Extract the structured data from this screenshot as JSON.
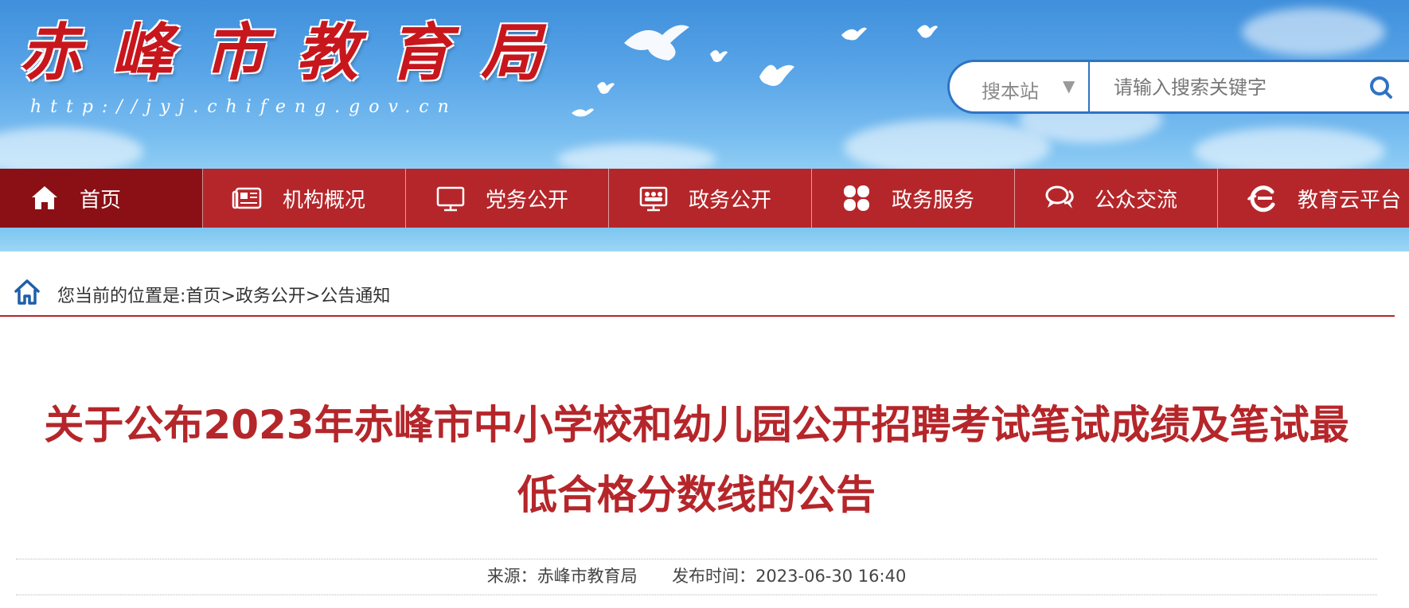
{
  "site": {
    "logo_text": "赤峰市教育局",
    "url": "http://jyj.chifeng.gov.cn"
  },
  "search": {
    "scope_label": "搜本站",
    "scope_arrow": "▼",
    "placeholder": "请输入搜索关键字"
  },
  "nav": {
    "items": [
      {
        "label": "首页",
        "icon": "home-icon",
        "active": true
      },
      {
        "label": "机构概况",
        "icon": "newspaper-icon"
      },
      {
        "label": "党务公开",
        "icon": "monitor-icon"
      },
      {
        "label": "政务公开",
        "icon": "board-icon"
      },
      {
        "label": "政务服务",
        "icon": "clover-icon"
      },
      {
        "label": "公众交流",
        "icon": "chat-icon"
      },
      {
        "label": "教育云平台",
        "icon": "cloud-e-icon"
      }
    ]
  },
  "breadcrumb": {
    "prefix": "您当前的位置是:",
    "items": [
      "首页",
      "政务公开",
      "公告通知"
    ],
    "separator": ">"
  },
  "article": {
    "title_line1": "关于公布2023年赤峰市中小学校和幼儿园公开招聘考试笔试成绩及笔试最",
    "title_line2": "低合格分数线的公告",
    "source_label": "来源：",
    "source": "赤峰市教育局",
    "date_label": "发布时间：",
    "date": "2023-06-30 16:40"
  },
  "colors": {
    "brand_red": "#b5262a",
    "active_nav_red": "#8a1015",
    "search_blue": "#2f73c4",
    "sky_blue": "#5aa6e8"
  }
}
